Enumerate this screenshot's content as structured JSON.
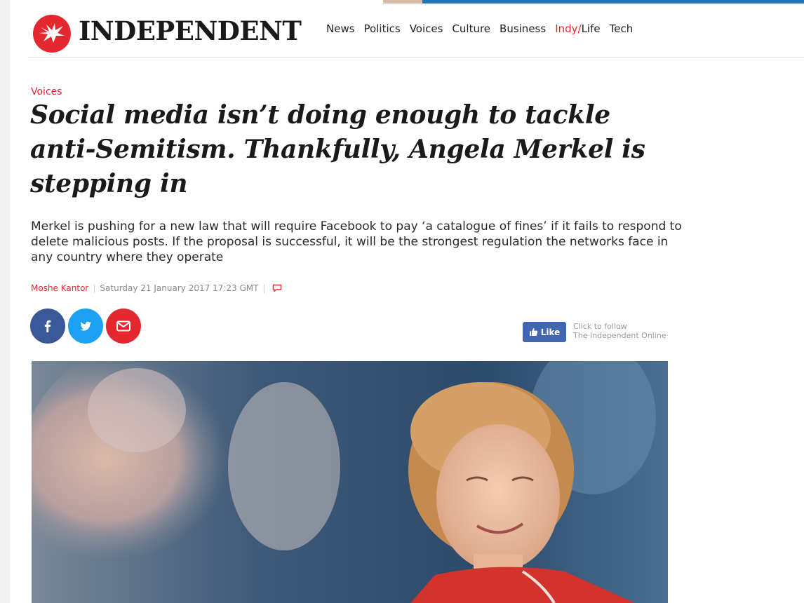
{
  "header": {
    "logo_text": "INDEPENDENT",
    "nav": [
      {
        "label": "News"
      },
      {
        "label": "Politics"
      },
      {
        "label": "Voices"
      },
      {
        "label": "Culture"
      },
      {
        "label": "Business"
      },
      {
        "label_indy": "Indy/",
        "label_life": "Life"
      },
      {
        "label": "Tech"
      }
    ]
  },
  "article": {
    "section": "Voices",
    "headline": "Social media isn’t doing enough to tackle anti-Semitism. Thankfully, Angela Merkel is stepping in",
    "standfirst": "Merkel is pushing for a new law that will require Facebook to pay ‘a catalogue of fines’ if it fails to respond to delete malicious posts. If the proposal is successful, it will be the strongest regulation the networks face in any country where they operate",
    "author": "Moshe Kantor",
    "date": "Saturday 21 January 2017 17:23 GMT",
    "separator": "|"
  },
  "social": {
    "share": [
      {
        "icon": "facebook-icon"
      },
      {
        "icon": "twitter-icon"
      },
      {
        "icon": "mail-icon"
      }
    ],
    "like_label": "Like",
    "follow_line1": "Click to follow",
    "follow_line2": "The Independent Online"
  },
  "colors": {
    "brand_red": "#e4282f",
    "facebook_blue": "#3b5998",
    "twitter_blue": "#1da1f2",
    "accent_blue": "#1f77b4"
  }
}
